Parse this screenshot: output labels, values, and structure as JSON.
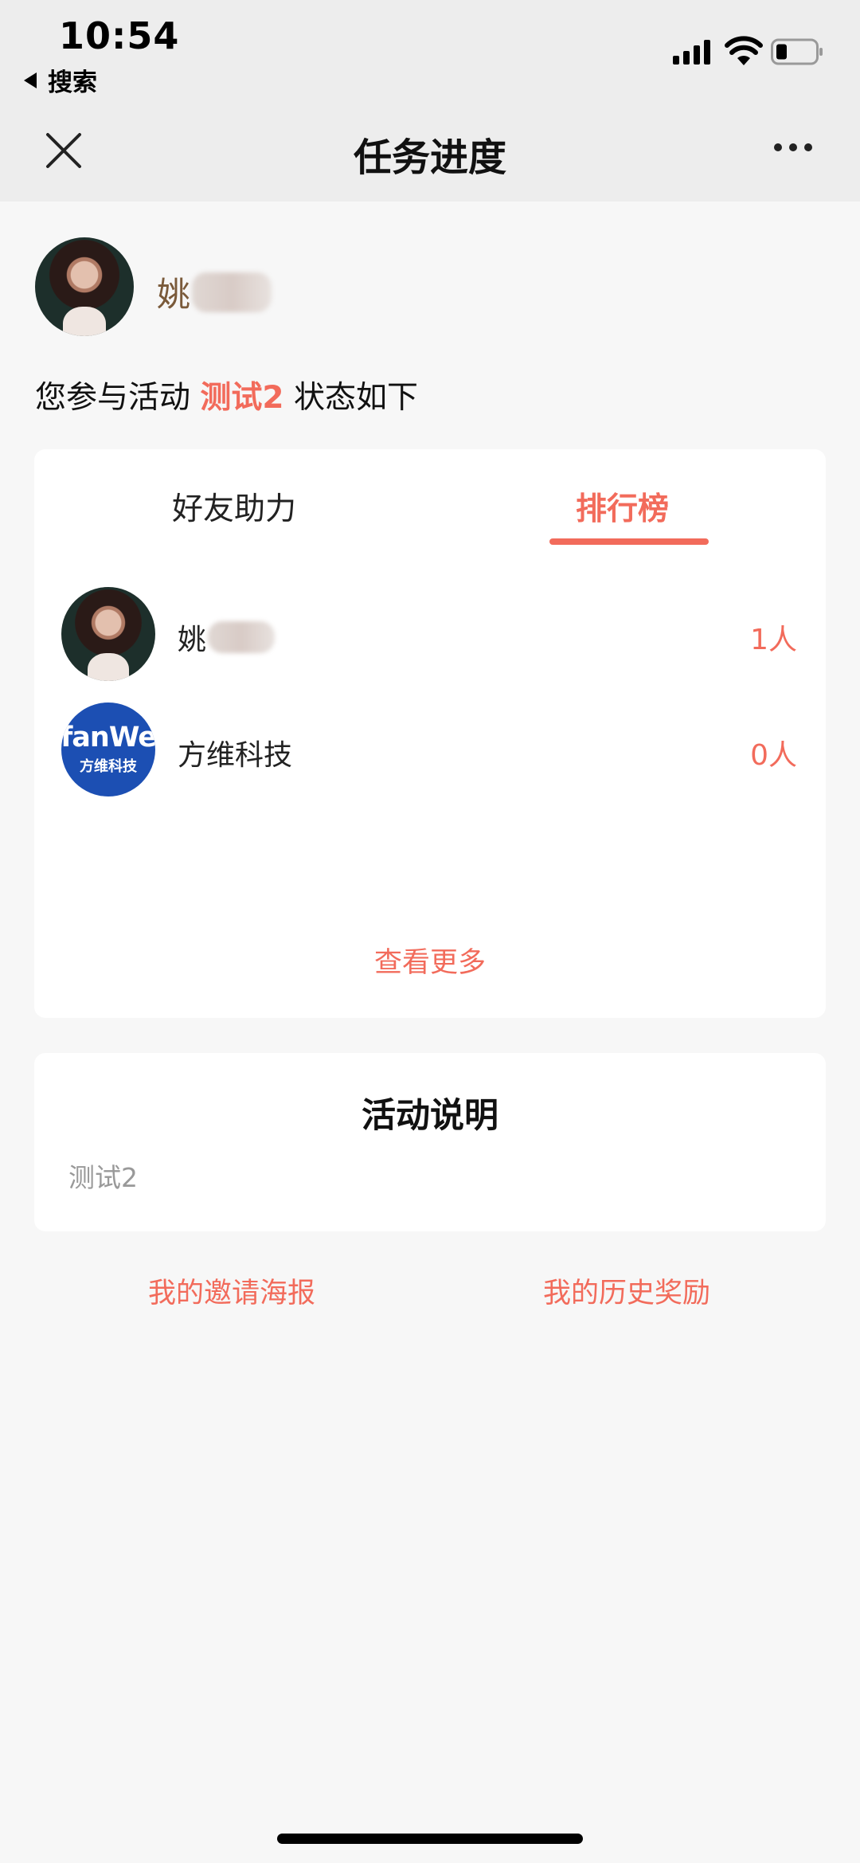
{
  "status_bar": {
    "time": "10:54",
    "back_app": "搜索"
  },
  "nav": {
    "title": "任务进度"
  },
  "user": {
    "name_visible": "姚"
  },
  "intro": {
    "prefix": "您参与活动",
    "activity": "测试2",
    "suffix": "状态如下"
  },
  "tabs": [
    {
      "label": "好友助力",
      "active": false
    },
    {
      "label": "排行榜",
      "active": true
    }
  ],
  "ranking": [
    {
      "name_visible": "姚",
      "count": "1人",
      "avatar": "portrait-photo"
    },
    {
      "name": "方维科技",
      "count": "0人",
      "avatar": "fanwe-logo"
    }
  ],
  "logo": {
    "line1": "fanWe",
    "line2": "方维科技"
  },
  "see_more": "查看更多",
  "activity_desc": {
    "title": "活动说明",
    "text": "测试2"
  },
  "links": {
    "poster": "我的邀请海报",
    "history": "我的历史奖励"
  },
  "colors": {
    "accent": "#f26b5b",
    "nav_bg": "#ededed",
    "page_bg": "#f7f7f7",
    "logo_bg": "#1c4fb3"
  }
}
